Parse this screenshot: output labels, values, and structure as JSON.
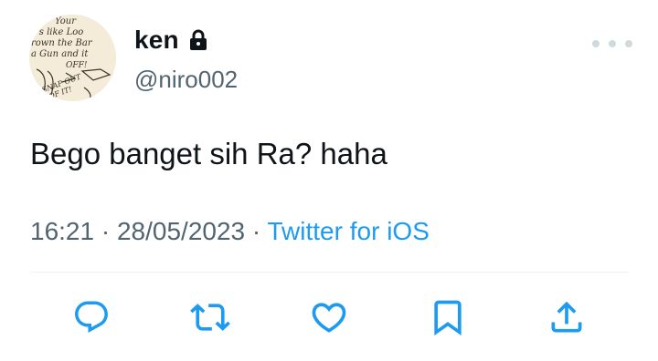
{
  "tweet": {
    "display_name": "ken",
    "handle": "@niro002",
    "text": "Bego banget sih Ra? haha",
    "time": "16:21",
    "separator": "·",
    "date": "28/05/2023",
    "source": "Twitter for iOS",
    "avatar_text": {
      "line1": "Your ",
      "line2": "t's like Loo",
      "line3": "rown the Bar",
      "line4": "a Gun and it",
      "line5": "OFF!",
      "line6": "SNAP OUT",
      "line7": "OF IT!"
    }
  },
  "icons": {
    "lock": "lock-icon",
    "more": "more-icon",
    "reply": "reply-icon",
    "retweet": "retweet-icon",
    "like": "heart-icon",
    "bookmark": "bookmark-icon",
    "share": "share-icon"
  },
  "colors": {
    "text": "#0f1419",
    "secondary": "#536471",
    "link": "#1d9bf0",
    "divider": "#eff3f4",
    "action_icons": "#1d9bf0"
  }
}
